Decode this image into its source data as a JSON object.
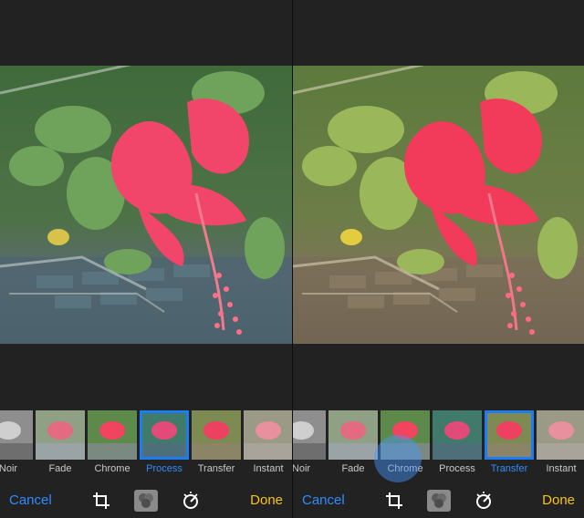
{
  "left": {
    "filters": [
      "Noir",
      "Fade",
      "Chrome",
      "Process",
      "Transfer",
      "Instant"
    ],
    "selected_index": 3,
    "toolbar": {
      "cancel_label": "Cancel",
      "done_label": "Done",
      "crop_icon": "crop-icon",
      "filters_icon": "filters-icon",
      "adjust_icon": "adjust-icon"
    }
  },
  "right": {
    "filters": [
      "Noir",
      "Fade",
      "Chrome",
      "Process",
      "Transfer",
      "Instant"
    ],
    "selected_index": 4,
    "toolbar": {
      "cancel_label": "Cancel",
      "done_label": "Done",
      "crop_icon": "crop-icon",
      "filters_icon": "filters-icon",
      "adjust_icon": "adjust-icon"
    }
  },
  "colors": {
    "accent_blue": "#2f8cff",
    "done_yellow": "#f5c518",
    "selected_border": "#1e7cf0",
    "background": "#222222"
  }
}
